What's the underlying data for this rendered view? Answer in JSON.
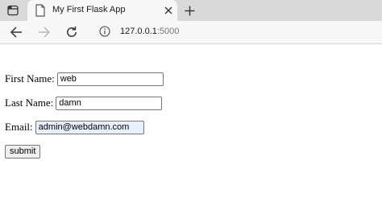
{
  "browser": {
    "tab": {
      "title": "My First Flask App",
      "favicon_icon": "page-icon"
    },
    "tab_actions_icon": "tab-actions-icon",
    "tab_close_icon": "close-icon",
    "new_tab_icon": "plus-icon",
    "nav": {
      "back_icon": "arrow-left-icon",
      "forward_icon": "arrow-right-icon",
      "forward_enabled": false,
      "refresh_icon": "refresh-icon"
    },
    "address_bar": {
      "info_icon": "info-icon",
      "host": "127.0.0.1",
      "port": ":5000"
    }
  },
  "form": {
    "first_name": {
      "label": "First Name:",
      "value": "web"
    },
    "last_name": {
      "label": "Last Name:",
      "value": "damn"
    },
    "email": {
      "label": "Email:",
      "value": "admin@webdamn.com"
    },
    "submit_label": "submit"
  },
  "colors": {
    "tabstrip_bg": "#d9d9d9",
    "toolbar_bg": "#f7f7f7",
    "autofill_bg": "#e8f0fe"
  }
}
